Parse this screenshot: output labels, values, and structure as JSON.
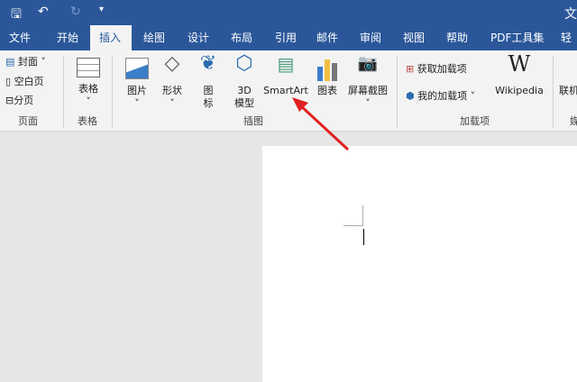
{
  "titlebar": {
    "title_partial": "文",
    "save": "save-icon",
    "undo": "undo-icon",
    "redo": "redo-icon",
    "customize": "customize-icon"
  },
  "tabs": [
    "文件",
    "开始",
    "插入",
    "绘图",
    "设计",
    "布局",
    "引用",
    "邮件",
    "审阅",
    "视图",
    "帮助",
    "PDF工具集",
    "轻闪"
  ],
  "active_tab": "插入",
  "ribbon": {
    "pages": {
      "items": [
        "封面",
        "空白页",
        "分页"
      ],
      "group": "页面"
    },
    "tables": {
      "item": "表格",
      "group": "表格"
    },
    "illustrations": {
      "items": [
        "图片",
        "形状",
        "图标",
        "3D模型",
        "SmartArt",
        "图表",
        "屏幕截图"
      ],
      "icon_label": [
        "图",
        "标"
      ],
      "model_label": [
        "3D",
        "模型"
      ],
      "group": "插图"
    },
    "addins": {
      "items": [
        "获取加载项",
        "我的加载项",
        "Wikipedia"
      ],
      "group": "加载项"
    },
    "media": {
      "item": "联机",
      "group": "媒"
    }
  },
  "colors": {
    "accent": "#2b579a",
    "arrow": "#e02020"
  }
}
